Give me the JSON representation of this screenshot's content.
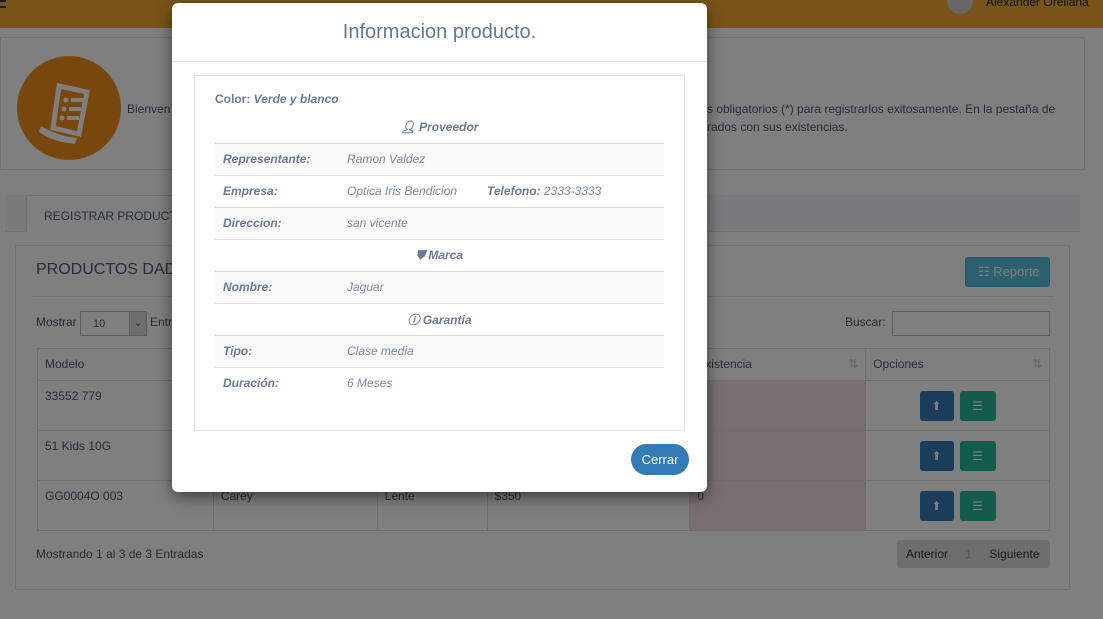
{
  "topbar": {
    "user_name": "Alexander Orellana"
  },
  "welcome": {
    "text_start": "Bienven",
    "text_line1_end": "s obligatorios (*) para registrarlos exitosamente. En la pestaña de",
    "text_line2_end": "rados con sus existencias."
  },
  "tabs": [
    {
      "label": "REGISTRAR PRODUCTOS"
    }
  ],
  "panel": {
    "title": "PRODUCTOS DADOS",
    "report_button": "Reporte",
    "show_label": "Mostrar",
    "show_value": "10",
    "entries_label": "Entradas",
    "search_label": "Buscar:",
    "search_value": ""
  },
  "table": {
    "headers": [
      "Modelo",
      "",
      "",
      "",
      "Existencia",
      "Opciones"
    ],
    "rows": [
      {
        "modelo": "33552 779",
        "c2": "",
        "c3": "",
        "c4": "",
        "existencia": ""
      },
      {
        "modelo": "51 Kids 10G",
        "c2": "",
        "c3": "",
        "c4": "",
        "existencia": ""
      },
      {
        "modelo": "GG0004O 003",
        "c2": "Carey",
        "c3": "Lente",
        "c4": "$350",
        "existencia": "0"
      }
    ]
  },
  "footer": {
    "info": "Mostrando 1 al 3 de 3 Entradas",
    "prev": "Anterior",
    "page": "1",
    "next": "Siguiente"
  },
  "modal": {
    "title": "Informacion producto.",
    "color_label": "Color:",
    "color_value": "Verde y blanco",
    "proveedor": {
      "title": "Proveedor",
      "representante_label": "Representante:",
      "representante": "Ramon Valdez",
      "empresa_label": "Empresa:",
      "empresa": "Optica Iris Bendicion",
      "telefono_label": "Telefono:",
      "telefono": "2333-3333",
      "direccion_label": "Direccion:",
      "direccion": "san vicente"
    },
    "marca": {
      "title": "Marca",
      "nombre_label": "Nombre:",
      "nombre": "Jaguar"
    },
    "garantia": {
      "title": "Garantia",
      "tipo_label": "Tipo:",
      "tipo": "Clase media",
      "duracion_label": "Duración:",
      "duracion": "6 Meses"
    },
    "close_button": "Cerrar"
  }
}
